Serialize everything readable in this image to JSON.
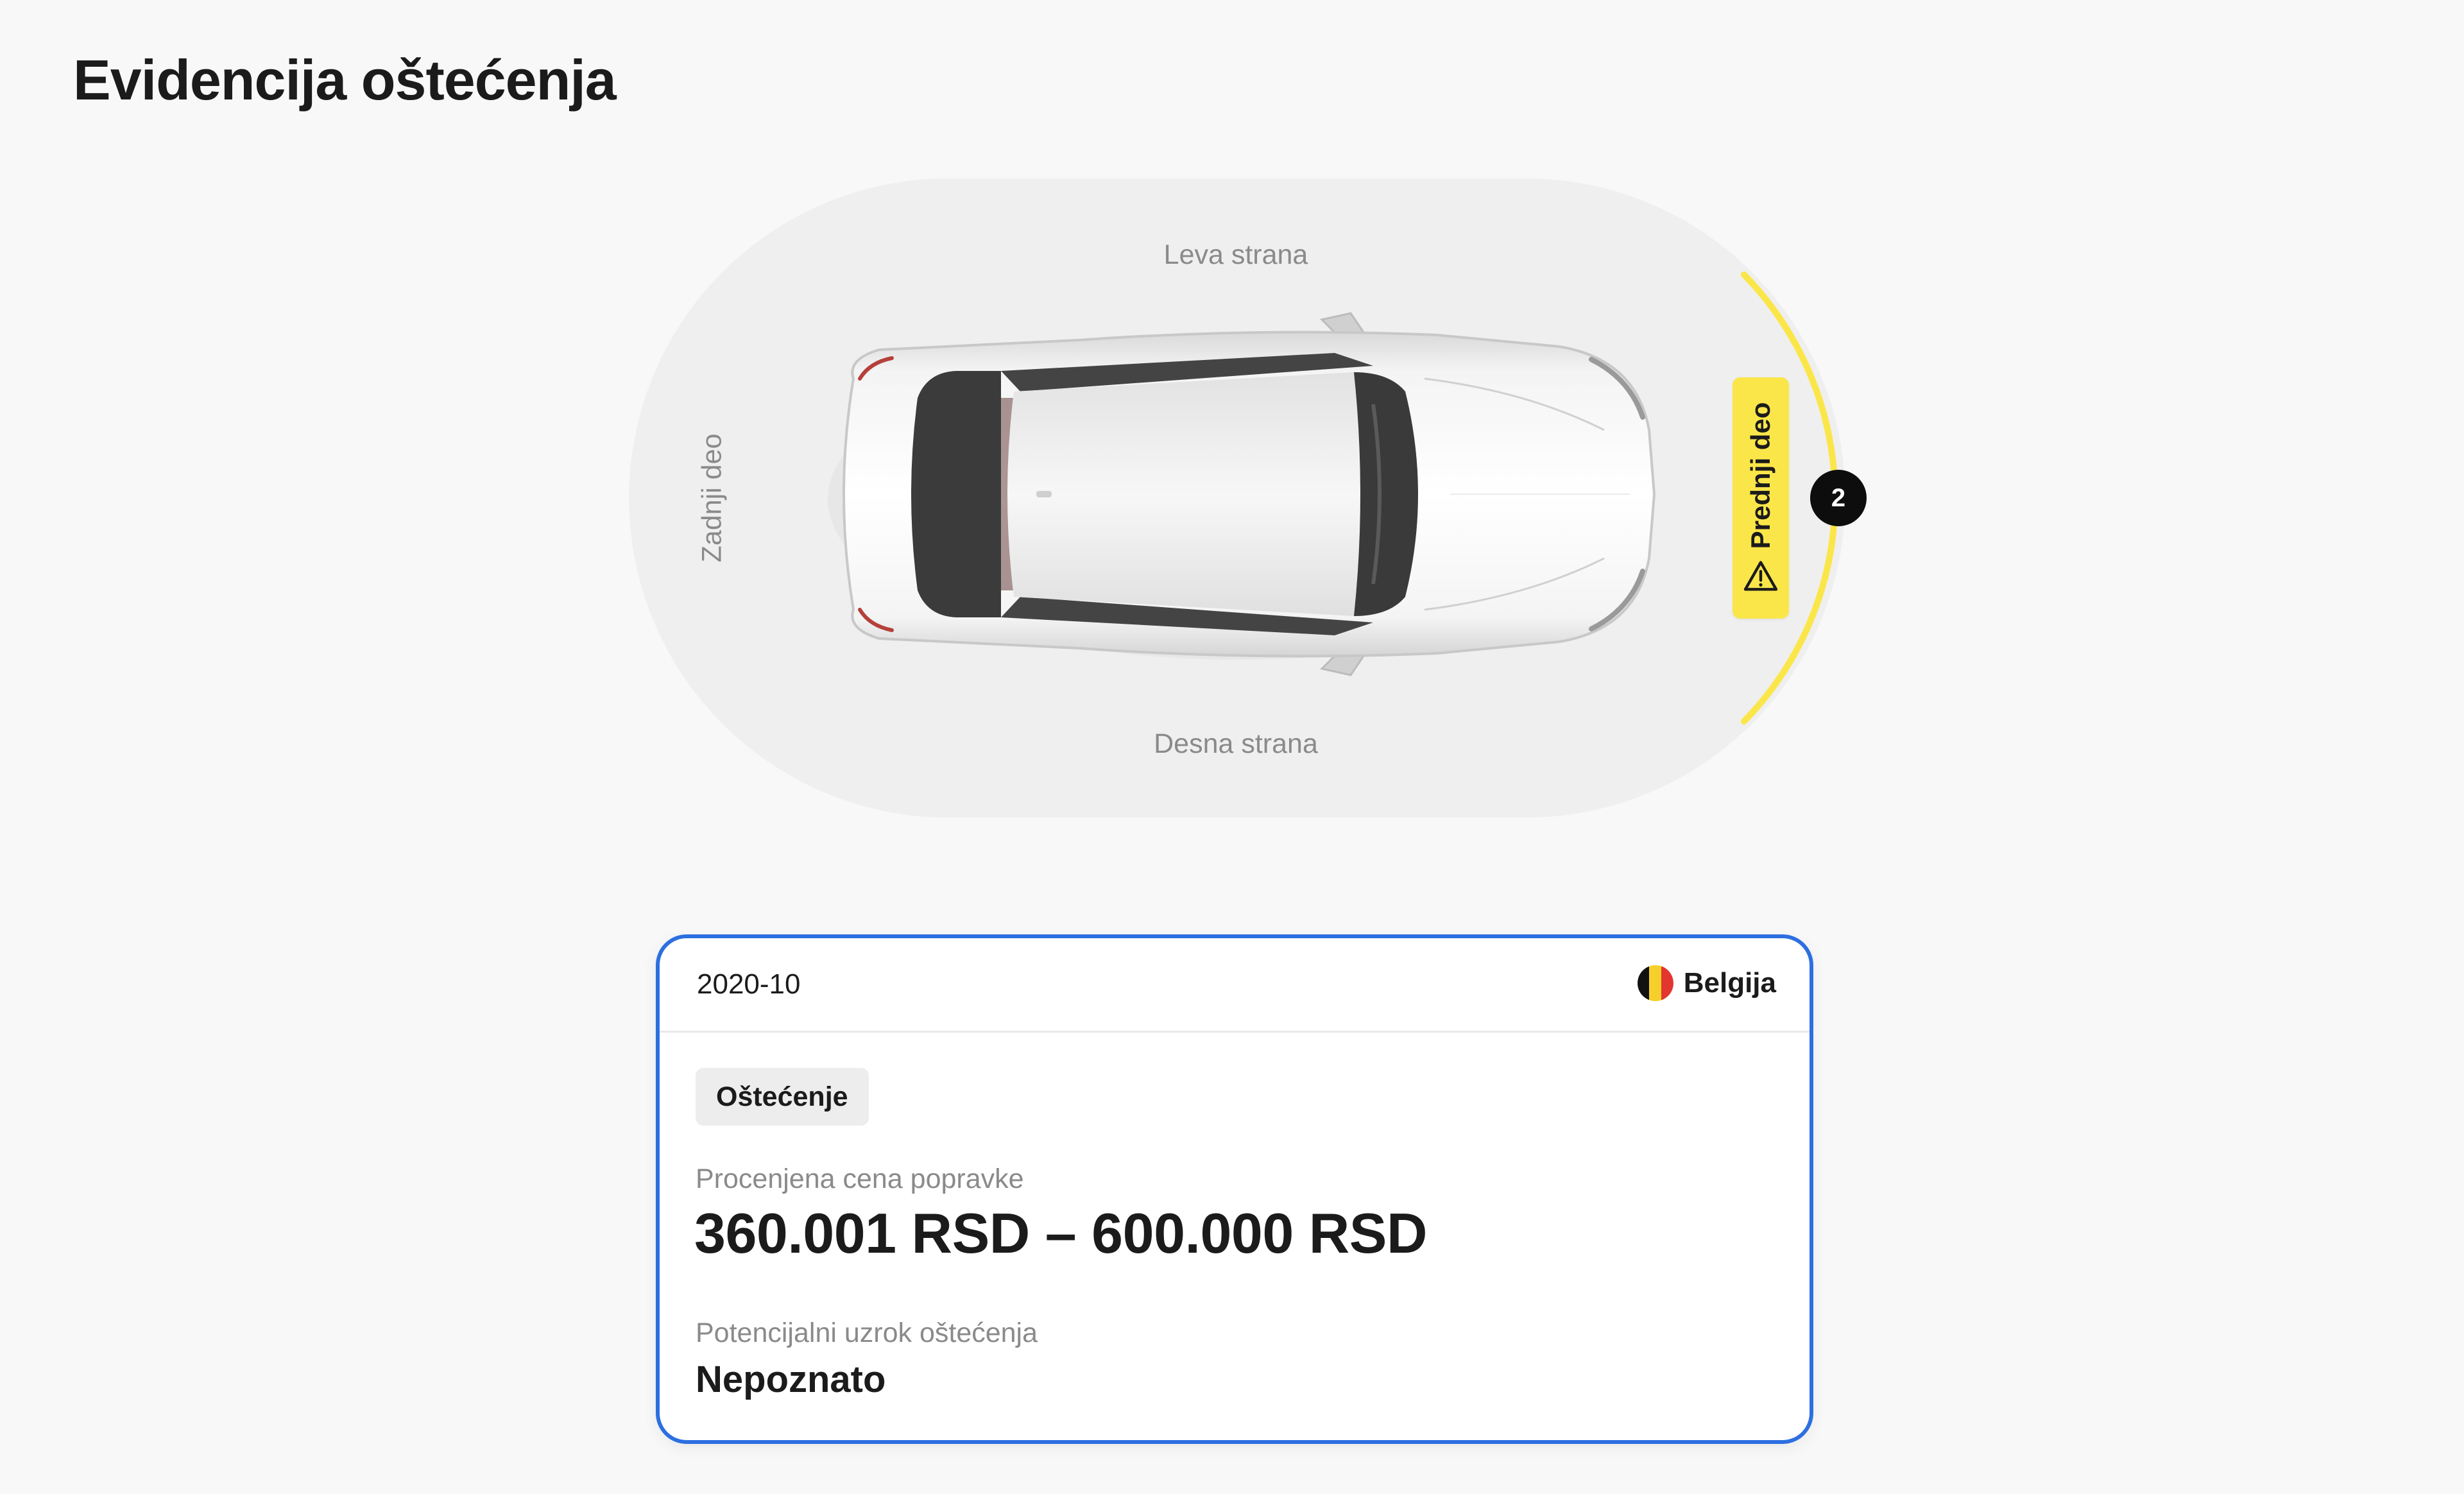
{
  "page": {
    "title": "Evidencija oštećenja"
  },
  "diagram": {
    "sides": {
      "left": "Leva strana",
      "right": "Desna strana",
      "rear": "Zadnji deo"
    },
    "front_zone": {
      "label": "Prednji deo",
      "icon": "warning-triangle-icon",
      "damage_count": "2",
      "highlight_color": "#fbe64a"
    }
  },
  "damage_card": {
    "date": "2020-10",
    "country": {
      "name": "Belgija",
      "flag_colors": [
        "#111111",
        "#f5d02b",
        "#e2362f"
      ]
    },
    "tag": "Oštećenje",
    "repair_cost": {
      "label": "Procenjena cena popravke",
      "value": "360.001 RSD – 600.000 RSD"
    },
    "cause": {
      "label": "Potencijalni uzrok oštećenja",
      "value": "Nepoznato"
    },
    "accent_color": "#2c6fe0"
  }
}
